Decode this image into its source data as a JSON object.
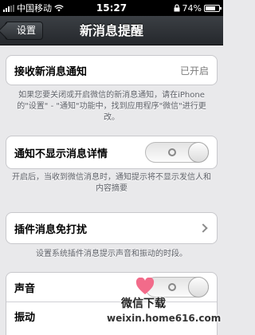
{
  "status_bar": {
    "carrier": "中国移动",
    "time": "15:27",
    "battery": "74%",
    "battery_level": 0.74,
    "icons": [
      "signal-icon",
      "wifi-icon",
      "lock-icon",
      "battery-icon"
    ]
  },
  "nav": {
    "back_label": "设置",
    "title": "新消息提醒"
  },
  "receive": {
    "label": "接收新消息通知",
    "value": "已开启",
    "description": "如果您要关闭或开启微信的新消息通知，请在iPhone的\"设置\" - \"通知\"功能中，找到应用程序\"微信\"进行更改。"
  },
  "hide_detail": {
    "label": "通知不显示消息详情",
    "toggle_on": false,
    "description": "开启后，当收到微信消息时，通知提示将不显示发信人和内容摘要"
  },
  "plugin": {
    "label": "插件消息免打扰",
    "description": "设置系统插件消息提示声音和振动的时段。"
  },
  "sound": {
    "label": "声音",
    "toggle_on": false
  },
  "vibrate": {
    "label": "振动"
  },
  "watermark": {
    "title": "微信下载",
    "url": "weixin.home616.com"
  },
  "colors": {
    "background": "#e9e9eb",
    "navbar": "#2e3236",
    "watermark_heart": "#f26b8a"
  }
}
